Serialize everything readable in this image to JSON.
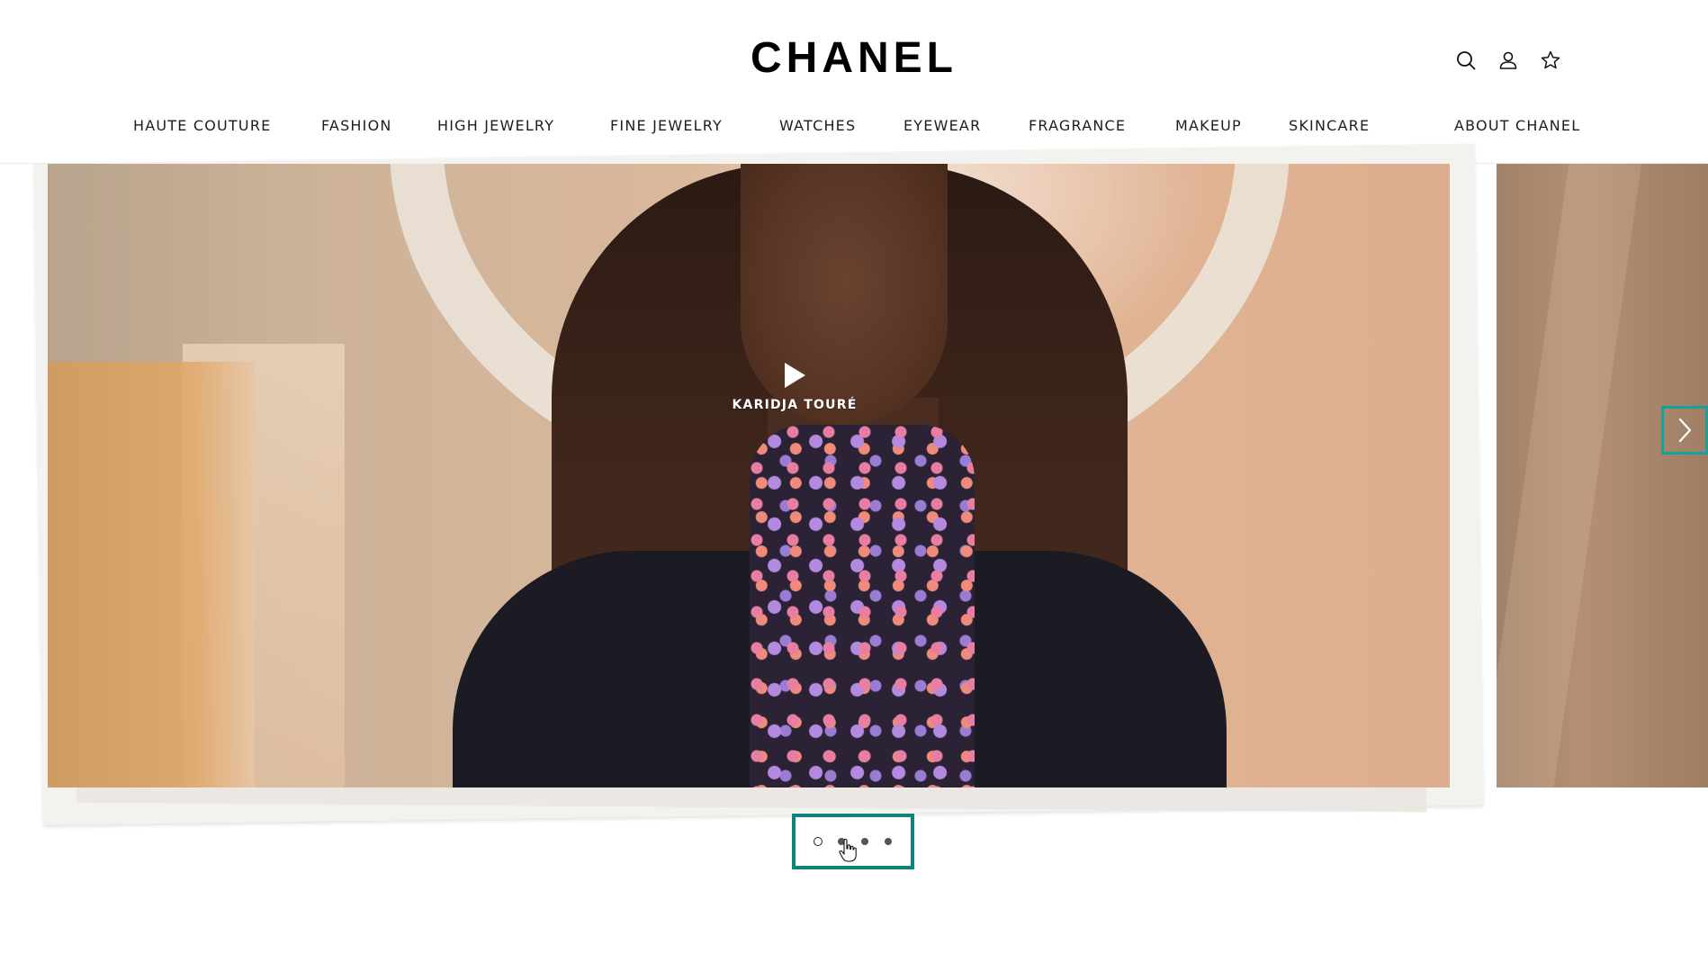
{
  "header": {
    "logo_text": "CHANEL",
    "icons": {
      "search": "search-icon",
      "account": "user-icon",
      "wishlist": "star-icon"
    },
    "nav": [
      {
        "label": "HAUTE COUTURE"
      },
      {
        "label": "FASHION"
      },
      {
        "label": "HIGH JEWELRY"
      },
      {
        "label": "FINE JEWELRY"
      },
      {
        "label": "WATCHES"
      },
      {
        "label": "EYEWEAR"
      },
      {
        "label": "FRAGRANCE"
      },
      {
        "label": "MAKEUP"
      },
      {
        "label": "SKINCARE"
      },
      {
        "label": "ABOUT CHANEL"
      }
    ]
  },
  "carousel": {
    "slide": {
      "label": "KARIDJA TOURÉ",
      "play_icon": "play-icon"
    },
    "next_icon": "chevron-right-icon",
    "dots": {
      "count": 4,
      "active_index": 0
    },
    "colors": {
      "focus_outline": "#14a39a",
      "dots_outline": "#0d847a"
    }
  }
}
